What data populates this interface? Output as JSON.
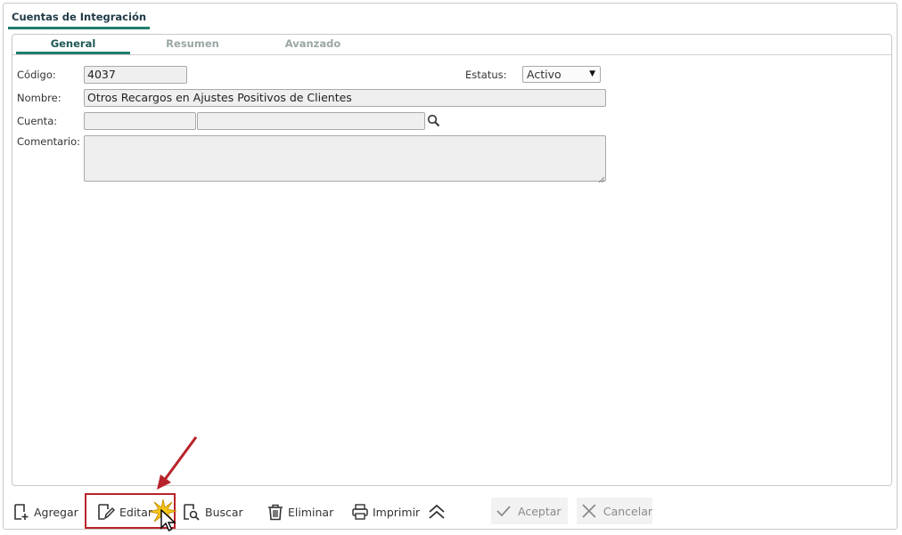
{
  "window": {
    "tab_title": "Cuentas de Integración"
  },
  "tabs": [
    {
      "label": "General",
      "active": true
    },
    {
      "label": "Resumen",
      "active": false
    },
    {
      "label": "Avanzado",
      "active": false
    }
  ],
  "form": {
    "codigo_label": "Código:",
    "codigo_value": "4037",
    "estatus_label": "Estatus:",
    "estatus_value": "Activo",
    "nombre_label": "Nombre:",
    "nombre_value": "Otros Recargos en Ajustes Positivos de Clientes",
    "cuenta_label": "Cuenta:",
    "cuenta_code_value": "",
    "cuenta_name_value": "",
    "comentario_label": "Comentario:",
    "comentario_value": ""
  },
  "toolbar": {
    "agregar": "Agregar",
    "editar": "Editar",
    "buscar": "Buscar",
    "eliminar": "Eliminar",
    "imprimir": "Imprimir",
    "aceptar": "Aceptar",
    "cancelar": "Cancelar"
  },
  "colors": {
    "accent": "#1e7d6b",
    "highlight": "#b8232a"
  },
  "icons": [
    "add-document-icon",
    "edit-document-icon",
    "search-document-icon",
    "trash-icon",
    "printer-icon",
    "collapse-up-icon",
    "check-icon",
    "x-icon",
    "magnifier-icon",
    "mouse-cursor-icon",
    "click-burst-icon",
    "annotation-arrow-icon"
  ]
}
